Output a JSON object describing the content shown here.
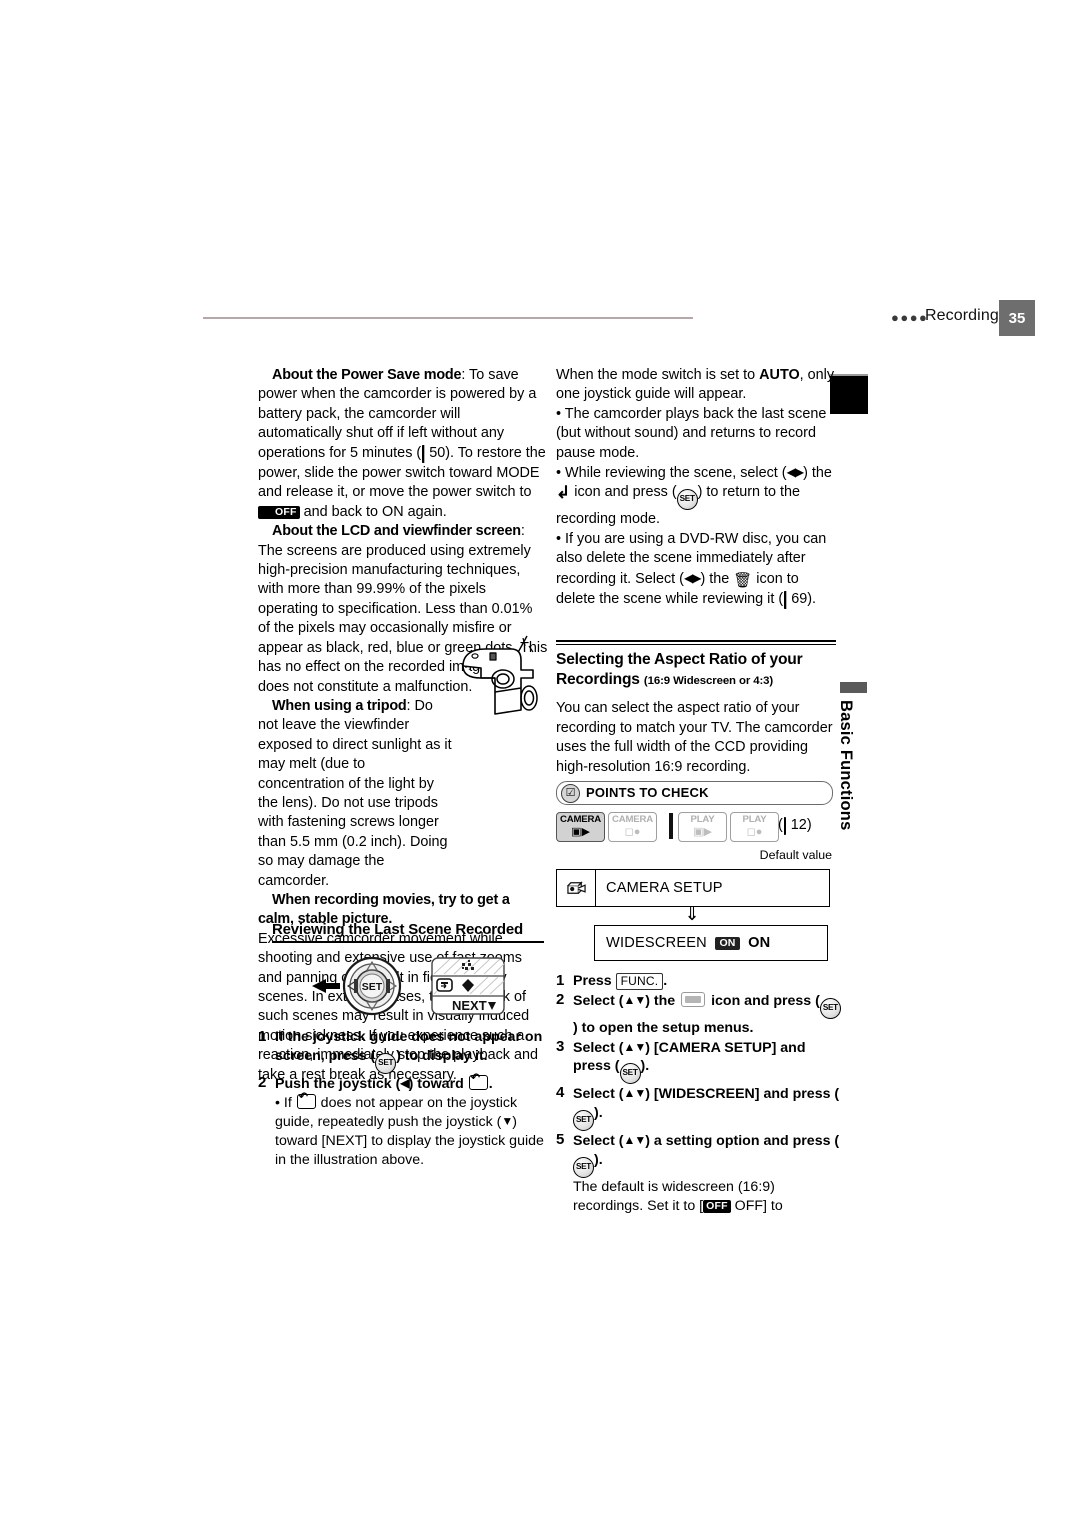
{
  "header": {
    "dots": "●●●●",
    "title": "Recording",
    "page_number": "35",
    "rule_color": "#b9a7a7",
    "pageno_bg": "#6e6e6e"
  },
  "side_tabs": {
    "vertical_label": "Basic Functions"
  },
  "left_column": {
    "power_save": {
      "lead": "About the Power Save mode",
      "text_1": ": To save power when the camcorder is powered by a battery pack, the camcorder will automatically shut off if left without any operations for 5 minutes (",
      "page_ref": "50",
      "text_2": "). To restore the power, slide the power switch toward MODE and release it, or move the power switch to ",
      "off_badge": "OFF",
      "text_3": " and back to ON again."
    },
    "lcd_viewfinder": {
      "lead": "About the LCD and viewfinder screen",
      "text": ": The screens are produced using extremely high-precision manufacturing techniques, with more than 99.99% of the pixels operating to specification. Less than 0.01% of the pixels may occasionally misfire or appear as black, red, blue or green dots. This has no effect on the recorded image and does not constitute a malfunction."
    },
    "tripod": {
      "lead": "When using a tripod",
      "text": ": Do not leave the viewfinder exposed to direct sunlight as it may melt (due to concentration of the light by the lens). Do not use tripods with fastening screws longer than 5.5 mm (0.2 inch). Doing so may damage the camcorder."
    },
    "stable_picture": {
      "lead": "When recording movies, try to get a calm, stable picture.",
      "text": "Excessive camcorder movement while shooting and extensive use of fast zooms and panning can result in fidgety, jittery scenes. In extreme cases, the playback of such scenes may result in visually induced motion sickness. If you experience such a reaction, immediately stop the playback and take a rest break as necessary."
    },
    "section_heading": "Reviewing the Last Scene Recorded",
    "joystick_illustration": {
      "set_label": "SET",
      "next_label": "NEXT"
    },
    "steps": [
      {
        "num": "1",
        "part_a": "If the joystick guide does not appear on screen, press (",
        "set": "SET",
        "part_b": ") to display it."
      },
      {
        "num": "2",
        "part_a": "Push the joystick (",
        "arrow": "◀",
        "part_b": ") toward ",
        "part_c": "."
      }
    ],
    "substep": {
      "part_a": "• If ",
      "part_b": " does not appear on the joystick guide, repeatedly push the joystick (",
      "arrow": "▼",
      "part_c": ") toward [NEXT] to display the joystick guide in the illustration above."
    }
  },
  "right_column": {
    "auto_note": "When the mode switch is set to AUTO, only one joystick guide will appear.",
    "auto_note_bold": "AUTO",
    "bullets": [
      {
        "text": "• The camcorder plays back the last scene (but without sound) and returns to record pause mode."
      }
    ],
    "bullet_review": {
      "part_a": "• While reviewing the scene, select (",
      "arrows": "◀▶",
      "part_b": ") the ",
      "return_icon": "↲",
      "part_c": " icon and press (",
      "set": "SET",
      "part_d": ") to return to the recording mode."
    },
    "bullet_delete": {
      "part_a": "• If you are using a DVD-RW disc, you can also delete the scene immediately after recording it. Select (",
      "arrows": "◀▶",
      "part_b": ") the ",
      "trash_icon": "🗑",
      "part_c": " icon to delete the scene while reviewing it (",
      "page_ref": "69",
      "part_d": ")."
    },
    "section_heading": {
      "title": "Selecting the Aspect Ratio of your Recordings",
      "subtitle": "(16:9 Widescreen or 4:3)"
    },
    "intro": "You can select the aspect ratio of your recording to match your TV. The camcorder uses the full width of the CCD providing high-resolution 16:9 recording.",
    "points_to_check": {
      "label": "POINTS TO CHECK",
      "check_glyph": "☑"
    },
    "mode_buttons": [
      {
        "label": "CAMERA",
        "glyph": "🎥",
        "active": true
      },
      {
        "label": "CAMERA",
        "glyph": "📷",
        "active": false
      },
      {
        "label": "PLAY",
        "glyph": "🎥",
        "active": false
      },
      {
        "label": "PLAY",
        "glyph": "📷",
        "active": false
      }
    ],
    "mode_ref": "12",
    "default_value_label": "Default value",
    "menu_flow": {
      "box1_label": "CAMERA SETUP",
      "arrow": "⇓",
      "box2_label": "WIDESCREEN",
      "box2_badge": "ON",
      "box2_value": "ON"
    },
    "steps": [
      {
        "num": "1",
        "part_a": "Press ",
        "func": "FUNC.",
        "part_b": "."
      },
      {
        "num": "2",
        "part_a": "Select (",
        "arrows": "▲▼",
        "part_b": ") the ",
        "part_c": " icon and press (",
        "set": "SET",
        "part_d": ") to open the setup menus."
      },
      {
        "num": "3",
        "part_a": "Select (",
        "arrows": "▲▼",
        "part_b": ") [CAMERA SETUP] and press (",
        "set": "SET",
        "part_d": ")."
      },
      {
        "num": "4",
        "part_a": "Select (",
        "arrows": "▲▼",
        "part_b": ") [WIDESCREEN] and press (",
        "set": "SET",
        "part_d": ")."
      },
      {
        "num": "5",
        "part_a": "Select (",
        "arrows": "▲▼",
        "part_b": ") a setting option and press (",
        "set": "SET",
        "part_d": ")."
      }
    ],
    "closing": {
      "part_a": "The default is widescreen (16:9) recordings. Set it to [",
      "off_badge": "OFF",
      "part_b": " OFF] to"
    }
  }
}
